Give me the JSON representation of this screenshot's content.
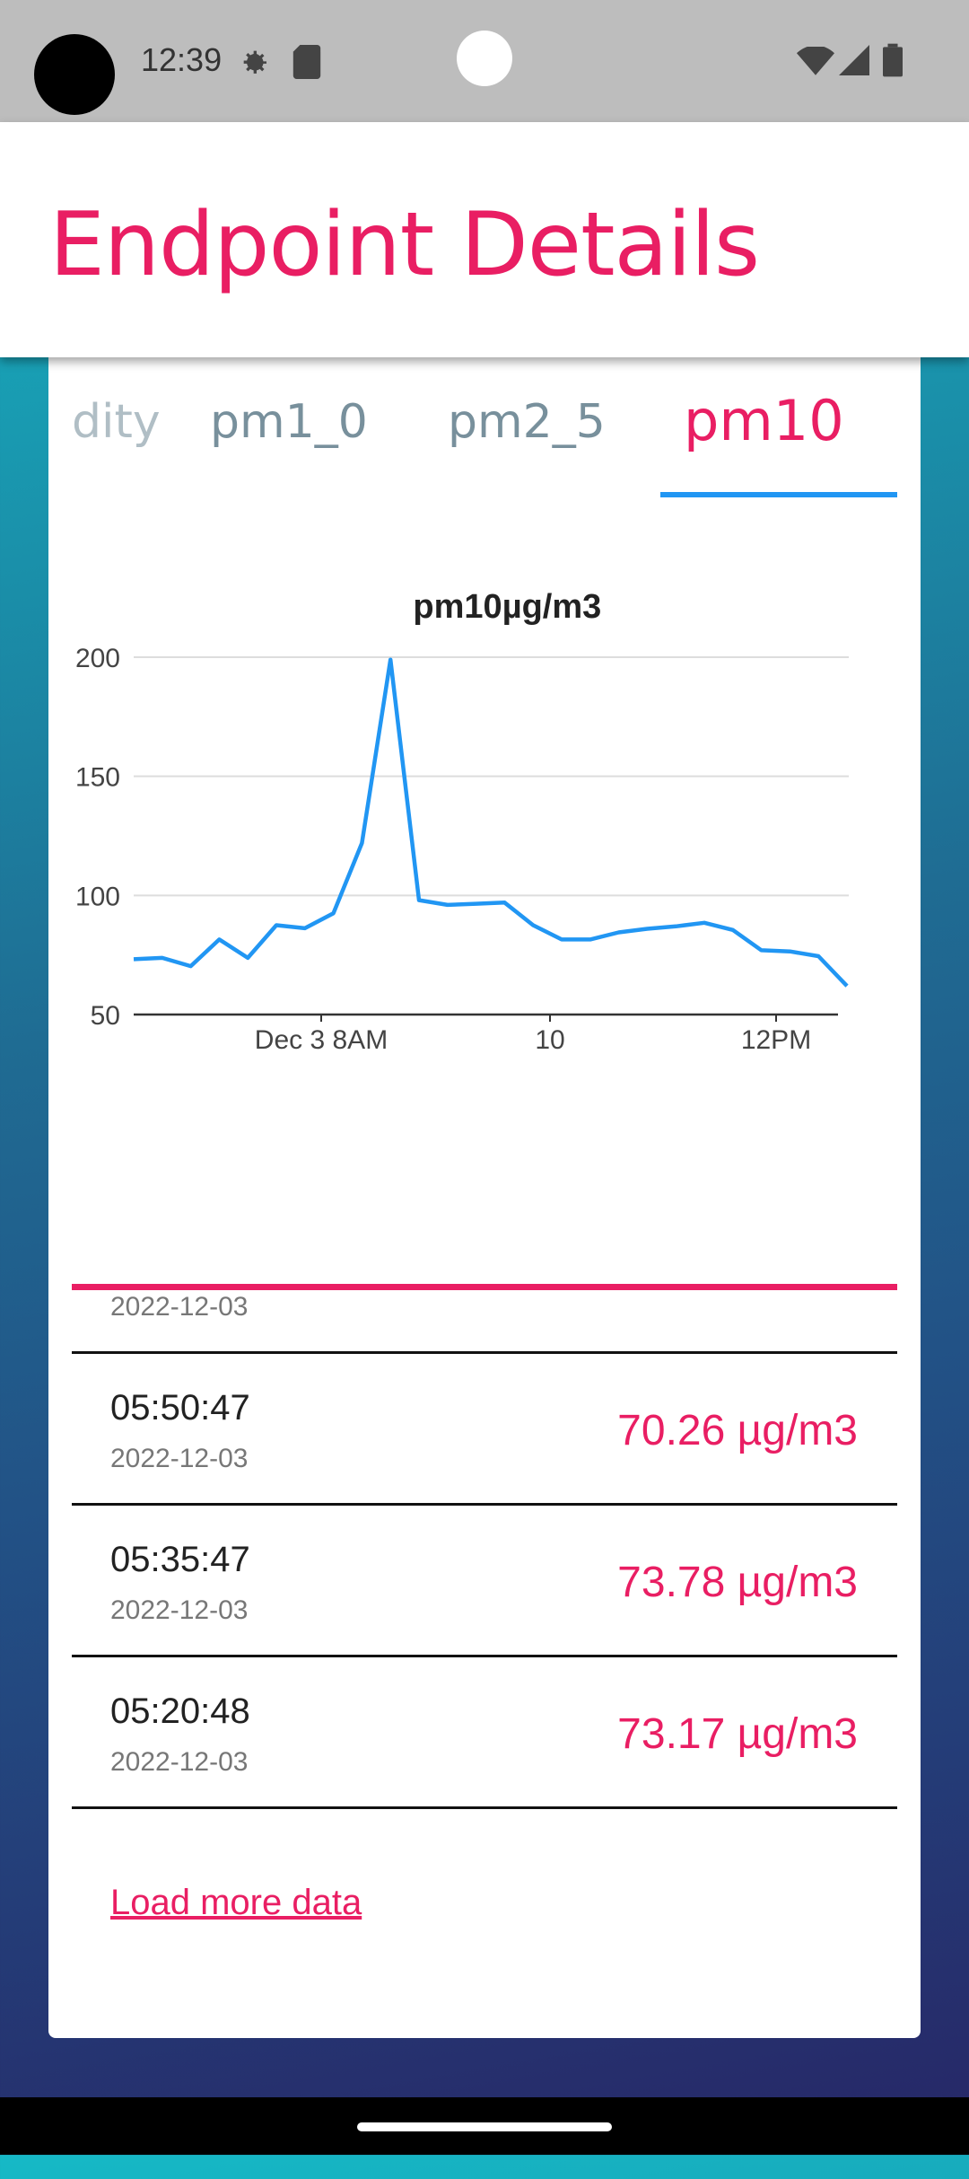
{
  "status_bar": {
    "time": "12:39",
    "icons": [
      "settings-gear-icon",
      "sd-card-icon",
      "wifi-icon",
      "signal-icon",
      "battery-icon"
    ]
  },
  "app_bar": {
    "title": "Endpoint Details"
  },
  "tabs": [
    {
      "label": "dity",
      "active": false
    },
    {
      "label": "pm1_0",
      "active": false
    },
    {
      "label": "pm2_5",
      "active": false
    },
    {
      "label": "pm10",
      "active": true
    }
  ],
  "chart_data": {
    "type": "line",
    "title": "pm10",
    "unit": "µg/m3",
    "ylim": [
      50,
      200
    ],
    "y_ticks": [
      200,
      150,
      100,
      50
    ],
    "x_tick_labels": [
      "Dec 3 8AM",
      "10",
      "12PM"
    ],
    "grid": true,
    "legend": "none",
    "series": [
      {
        "color": "#2196f3",
        "values": [
          73.2,
          73.8,
          70.3,
          81.5,
          73.8,
          87.5,
          86.2,
          92.5,
          122,
          199,
          98,
          96,
          96.5,
          97,
          87.5,
          81.5,
          81.5,
          84.5,
          86,
          87,
          88.5,
          85.5,
          77,
          76.5,
          74.5,
          62
        ]
      }
    ]
  },
  "readings": [
    {
      "time": "",
      "date": "2022-12-03",
      "value": ""
    },
    {
      "time": "05:50:47",
      "date": "2022-12-03",
      "value": "70.26 µg/m3"
    },
    {
      "time": "05:35:47",
      "date": "2022-12-03",
      "value": "73.78 µg/m3"
    },
    {
      "time": "05:20:48",
      "date": "2022-12-03",
      "value": "73.17 µg/m3"
    }
  ],
  "load_more": "Load more data",
  "colors": {
    "accent": "#e91e63",
    "chart_line": "#2196f3",
    "tab_inactive": "#78909c"
  }
}
